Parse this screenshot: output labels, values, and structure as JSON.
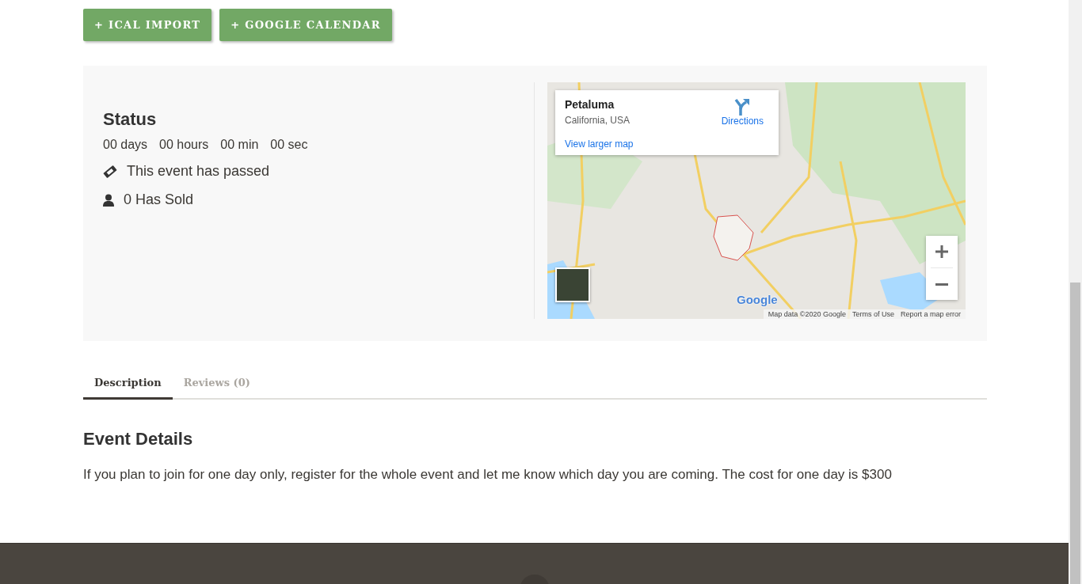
{
  "buttons": [
    {
      "label": "+ ICAL IMPORT"
    },
    {
      "label": "+ GOOGLE CALENDAR"
    }
  ],
  "status": {
    "title": "Status",
    "countdown": [
      "00 days",
      "00 hours",
      "00 min",
      "00 sec"
    ],
    "items": [
      {
        "kind": "ticket",
        "text": "This event has passed"
      },
      {
        "kind": "person",
        "text": "0 Has Sold"
      }
    ]
  },
  "map": {
    "place": "Petaluma",
    "region": "California, USA",
    "directions": "Directions",
    "larger_link": "View larger map",
    "logo": "Google",
    "attribution": [
      "Map data ©2020 Google",
      "Terms of Use",
      "Report a map error"
    ]
  },
  "tabs": [
    {
      "label": "Description",
      "selected": true
    },
    {
      "label": "Reviews (0)",
      "selected": false
    }
  ],
  "details": {
    "title": "Event Details",
    "text": "If you plan to join for one day only, register for the whole event and let me know which day you are coming. The cost for one day is $300"
  }
}
